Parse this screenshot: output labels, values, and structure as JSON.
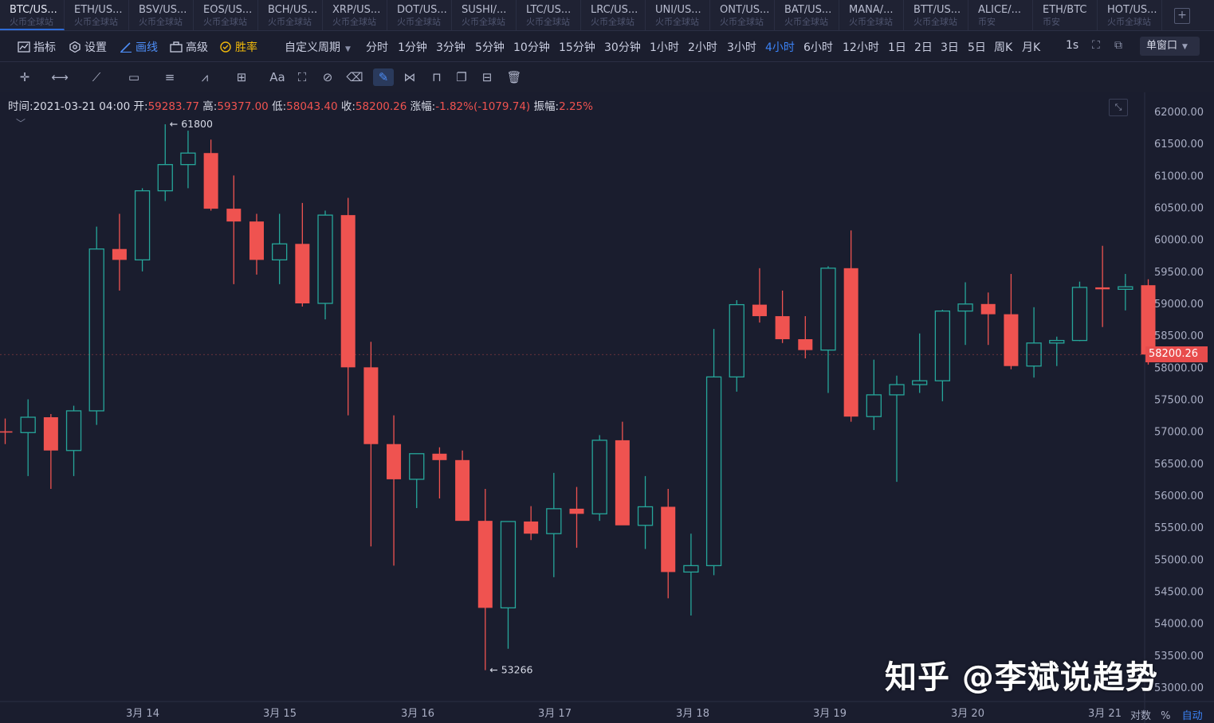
{
  "tabs": [
    {
      "name": "BTC/US...",
      "sub": "火币全球站"
    },
    {
      "name": "ETH/US...",
      "sub": "火币全球站"
    },
    {
      "name": "BSV/US...",
      "sub": "火币全球站"
    },
    {
      "name": "EOS/US...",
      "sub": "火币全球站"
    },
    {
      "name": "BCH/US...",
      "sub": "火币全球站"
    },
    {
      "name": "XRP/US...",
      "sub": "火币全球站"
    },
    {
      "name": "DOT/US...",
      "sub": "火币全球站"
    },
    {
      "name": "SUSHI/...",
      "sub": "火币全球站"
    },
    {
      "name": "LTC/US...",
      "sub": "火币全球站"
    },
    {
      "name": "LRC/US...",
      "sub": "火币全球站"
    },
    {
      "name": "UNI/US...",
      "sub": "火币全球站"
    },
    {
      "name": "ONT/US...",
      "sub": "火币全球站"
    },
    {
      "name": "BAT/US...",
      "sub": "火币全球站"
    },
    {
      "name": "MANA/...",
      "sub": "火币全球站"
    },
    {
      "name": "BTT/US...",
      "sub": "火币全球站"
    },
    {
      "name": "ALICE/...",
      "sub": "币安"
    },
    {
      "name": "ETH/BTC",
      "sub": "币安"
    },
    {
      "name": "HOT/US...",
      "sub": "火币全球站"
    }
  ],
  "tab_add": "+",
  "toolbar": {
    "indicators": "指标",
    "settings": "设置",
    "draw": "画线",
    "advanced": "高级",
    "winrate": "胜率",
    "custom_period": "自定义周期",
    "periods": [
      "分时",
      "1分钟",
      "3分钟",
      "5分钟",
      "10分钟",
      "15分钟",
      "30分钟",
      "1小时",
      "2小时",
      "3小时",
      "4小时",
      "6小时",
      "12小时",
      "1日",
      "2日",
      "3日",
      "5日",
      "周K",
      "月K"
    ],
    "active_period": "4小时",
    "interval": "1s",
    "window_mode": "单窗口"
  },
  "draw_tools": [
    {
      "icon": "crosshair-icon",
      "glyph": "✛"
    },
    {
      "icon": "horizontal-line-icon",
      "glyph": "⟷"
    },
    {
      "icon": "trend-line-icon",
      "glyph": "⟋"
    },
    {
      "icon": "rectangle-icon",
      "glyph": "▭"
    },
    {
      "icon": "fib-lines-icon",
      "glyph": "≡"
    },
    {
      "icon": "wave-icon",
      "glyph": "⩘"
    },
    {
      "icon": "measure-icon",
      "glyph": "⊞"
    },
    {
      "icon": "text-icon",
      "glyph": "Aa"
    },
    {
      "icon": "magnet-icon",
      "glyph": "⛶"
    },
    {
      "icon": "hide-drawings-icon",
      "glyph": "⊘"
    },
    {
      "icon": "eraser-icon",
      "glyph": "⌫"
    },
    {
      "icon": "continuous-draw-icon",
      "glyph": "✎"
    },
    {
      "icon": "pattern-icon",
      "glyph": "⋈"
    },
    {
      "icon": "lock-icon",
      "glyph": "⊓"
    },
    {
      "icon": "copy-icon",
      "glyph": "❐"
    },
    {
      "icon": "drawing-settings-icon",
      "glyph": "⊟"
    },
    {
      "icon": "delete-icon",
      "glyph": "🗑"
    }
  ],
  "info": {
    "time_label": "时间:",
    "time": "2021-03-21 04:00",
    "open_label": "开:",
    "open": "59283.77",
    "high_label": "高:",
    "high": "59377.00",
    "low_label": "低:",
    "low": "58043.40",
    "close_label": "收:",
    "close": "58200.26",
    "change_label": "涨幅:",
    "change": "-1.82%(-1079.74)",
    "amplitude_label": "振幅:",
    "amplitude": "2.25%"
  },
  "colors": {
    "up": "#26a69a",
    "down": "#ef5350",
    "background": "#1a1d2e",
    "active": "#3b82f6"
  },
  "chart_data": {
    "type": "candlestick",
    "ylim": [
      53000,
      62000
    ],
    "yticks": [
      "62000.00",
      "61500.00",
      "61000.00",
      "60500.00",
      "60000.00",
      "59500.00",
      "59000.00",
      "58500.00",
      "58000.00",
      "57500.00",
      "57000.00",
      "56500.00",
      "56000.00",
      "55500.00",
      "55000.00",
      "54500.00",
      "54000.00",
      "53500.00",
      "53000.00"
    ],
    "xticks": [
      "3月 14",
      "3月 15",
      "3月 16",
      "3月 17",
      "3月 18",
      "3月 19",
      "3月 20",
      "3月 21"
    ],
    "current_price": "58200.26",
    "high_marker": "61800",
    "low_marker": "53266",
    "candles": [
      [
        57000,
        57200,
        56800,
        56980
      ],
      [
        56980,
        57500,
        56300,
        57220
      ],
      [
        57220,
        57270,
        56100,
        56700
      ],
      [
        56700,
        57400,
        56300,
        57320
      ],
      [
        57320,
        60200,
        57100,
        59850
      ],
      [
        59850,
        60400,
        59200,
        59680
      ],
      [
        59680,
        60800,
        59500,
        60760
      ],
      [
        60760,
        61800,
        60600,
        61170
      ],
      [
        61170,
        61700,
        60800,
        61350
      ],
      [
        61350,
        61560,
        60450,
        60480
      ],
      [
        60480,
        61000,
        59300,
        60280
      ],
      [
        60280,
        60400,
        59450,
        59680
      ],
      [
        59680,
        60400,
        59300,
        59930
      ],
      [
        59930,
        60570,
        58950,
        59000
      ],
      [
        59000,
        60450,
        58750,
        60380
      ],
      [
        60380,
        60650,
        57250,
        58000
      ],
      [
        58000,
        58400,
        55200,
        56800
      ],
      [
        56800,
        57250,
        54900,
        56250
      ],
      [
        56250,
        56650,
        55800,
        56650
      ],
      [
        56650,
        56750,
        55950,
        56550
      ],
      [
        56550,
        56700,
        55700,
        55600
      ],
      [
        55600,
        56100,
        53266,
        54240
      ],
      [
        54240,
        55530,
        53600,
        55590
      ],
      [
        55590,
        55830,
        55300,
        55400
      ],
      [
        55400,
        56350,
        54720,
        55790
      ],
      [
        55790,
        56130,
        55180,
        55710
      ],
      [
        55710,
        56940,
        55600,
        56860
      ],
      [
        56860,
        57150,
        55600,
        55530
      ],
      [
        55530,
        56300,
        55160,
        55820
      ],
      [
        55820,
        56100,
        54390,
        54800
      ],
      [
        54800,
        55400,
        54120,
        54900
      ],
      [
        54900,
        58600,
        54750,
        57850
      ],
      [
        57850,
        59050,
        57620,
        58980
      ],
      [
        58980,
        59550,
        58700,
        58800
      ],
      [
        58800,
        59200,
        58380,
        58440
      ],
      [
        58440,
        58800,
        58140,
        58270
      ],
      [
        58270,
        59580,
        57600,
        59550
      ],
      [
        59550,
        60140,
        57150,
        57230
      ],
      [
        57230,
        58120,
        57020,
        57570
      ],
      [
        57570,
        57870,
        56210,
        57730
      ],
      [
        57730,
        58530,
        57600,
        57790
      ],
      [
        57790,
        58900,
        57470,
        58880
      ],
      [
        58880,
        59330,
        58350,
        58990
      ],
      [
        58990,
        59170,
        58350,
        58830
      ],
      [
        58830,
        59460,
        57970,
        58020
      ],
      [
        58020,
        58940,
        57840,
        58380
      ],
      [
        58380,
        58480,
        58020,
        58420
      ],
      [
        58420,
        59340,
        58410,
        59250
      ],
      [
        59250,
        59900,
        58630,
        59220
      ],
      [
        59220,
        59460,
        58890,
        59260
      ],
      [
        59283.77,
        59377,
        58043.4,
        58200.26
      ]
    ]
  },
  "watermark": "知乎 @李斌说趋势",
  "bottom": {
    "log": "对数",
    "percent": "%",
    "auto": "自动"
  }
}
